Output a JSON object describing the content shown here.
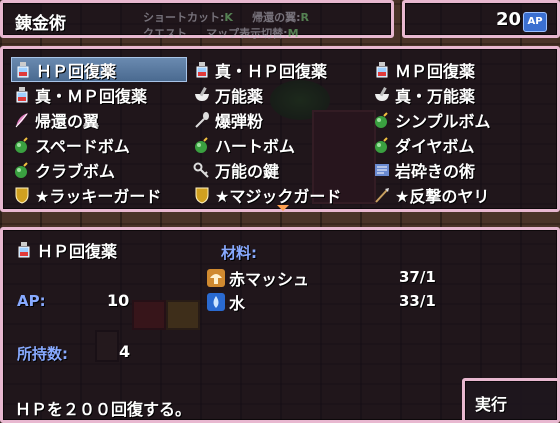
{
  "header": {
    "title": "錬金術",
    "ghost_shortcut": "ショートカット",
    "ghost_shortcut_key": "K",
    "ghost_return": "帰還の翼",
    "ghost_return_key": "R",
    "ghost_row2": "クエスト",
    "ghost_row2b": "マップ表示切替",
    "ghost_row2b_key": "M"
  },
  "ap": {
    "value": "20",
    "badge": "AP"
  },
  "list": {
    "items": [
      {
        "label": "ＨＰ回復薬",
        "icon": "potion-icon",
        "selected": true
      },
      {
        "label": "真・ＨＰ回復薬",
        "icon": "potion-icon"
      },
      {
        "label": "ＭＰ回復薬",
        "icon": "potion-icon"
      },
      {
        "label": "真・ＭＰ回復薬",
        "icon": "potion-icon"
      },
      {
        "label": "万能薬",
        "icon": "mortar-icon"
      },
      {
        "label": "真・万能薬",
        "icon": "mortar-icon"
      },
      {
        "label": "帰還の翼",
        "icon": "feather-icon"
      },
      {
        "label": "爆弾粉",
        "icon": "spoon-icon"
      },
      {
        "label": "シンプルボム",
        "icon": "bomb-icon"
      },
      {
        "label": "スペードボム",
        "icon": "bomb-icon"
      },
      {
        "label": "ハートボム",
        "icon": "bomb-icon"
      },
      {
        "label": "ダイヤボム",
        "icon": "bomb-icon"
      },
      {
        "label": "クラブボム",
        "icon": "bomb-icon"
      },
      {
        "label": "万能の鍵",
        "icon": "key-icon"
      },
      {
        "label": "岩砕きの術",
        "icon": "scroll-icon"
      },
      {
        "label": "★ラッキーガード",
        "icon": "shield-icon"
      },
      {
        "label": "★マジックガード",
        "icon": "shield-icon"
      },
      {
        "label": "★反撃のヤリ",
        "icon": "spear-icon"
      }
    ]
  },
  "detail": {
    "name": "ＨＰ回復薬",
    "materials_label": "材料:",
    "materials": [
      {
        "name": "赤マッシュ",
        "count": "37/1",
        "icon": "mushroom-icon"
      },
      {
        "name": "水",
        "count": "33/1",
        "icon": "water-icon"
      }
    ],
    "ap_label": "AP:",
    "ap_value": "10",
    "owned_label": "所持数:",
    "owned_value": "4",
    "description": "ＨＰを２００回復する。"
  },
  "execute": {
    "label": "実行"
  },
  "colors": {
    "frame": "#e8b8d0",
    "label_blue": "#88aaff",
    "selection": "#5a7aa0"
  }
}
